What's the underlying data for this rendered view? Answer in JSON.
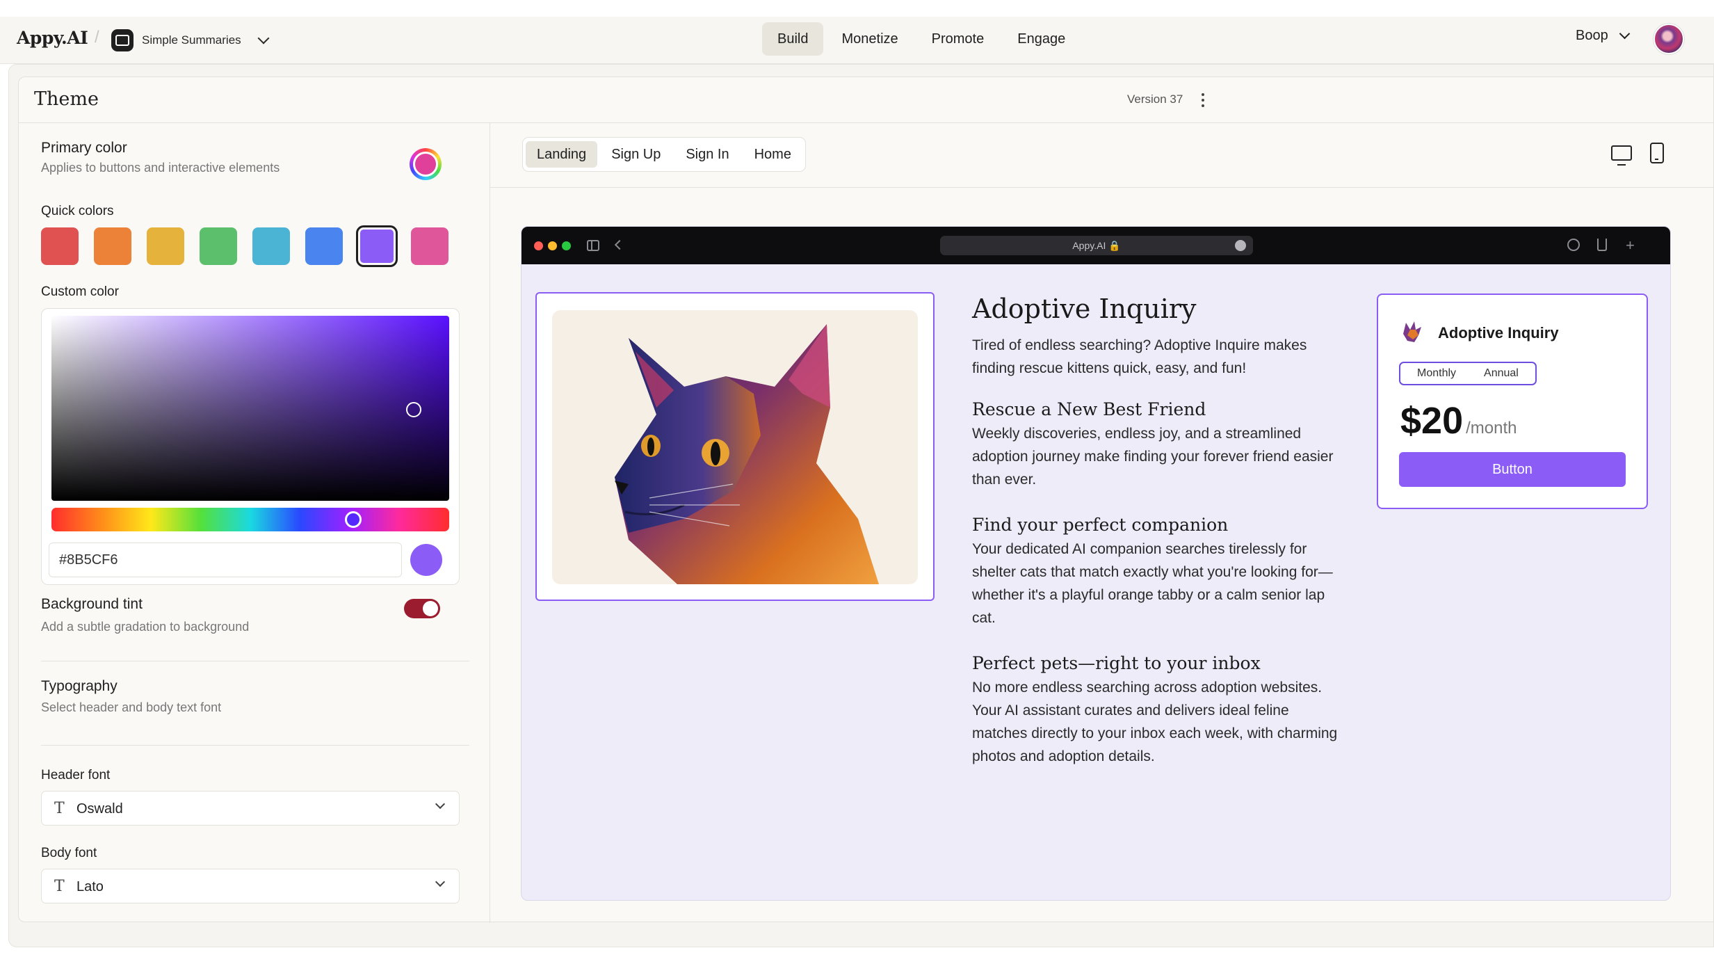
{
  "topnav": {
    "brand": "Appy.AI",
    "separator": "/",
    "app_name": "Simple Summaries",
    "tabs": [
      {
        "label": "Build",
        "active": true
      },
      {
        "label": "Monetize",
        "active": false
      },
      {
        "label": "Promote",
        "active": false
      },
      {
        "label": "Engage",
        "active": false
      }
    ],
    "user_name": "Boop"
  },
  "panel": {
    "title": "Theme",
    "version": "Version 37"
  },
  "theme": {
    "primary": {
      "label": "Primary color",
      "description": "Applies to buttons and interactive  elements"
    },
    "quick_colors": {
      "label": "Quick colors",
      "colors": [
        "#e05252",
        "#eb8238",
        "#e5b23b",
        "#5bbf6b",
        "#4bb3d4",
        "#4a84ee",
        "#8b5cf6",
        "#e0569a"
      ],
      "selected_index": 6
    },
    "custom": {
      "label": "Custom color",
      "hex": "#8B5CF6"
    },
    "background_tint": {
      "label": "Background tint",
      "description": "Add a subtle gradation to background",
      "enabled": true
    },
    "typography": {
      "label": "Typography",
      "description": "Select header and body text font"
    },
    "header_font": {
      "label": "Header font",
      "value": "Oswald"
    },
    "body_font": {
      "label": "Body font",
      "value": "Lato"
    }
  },
  "preview": {
    "page_tabs": [
      {
        "label": "Landing",
        "active": true
      },
      {
        "label": "Sign Up",
        "active": false
      },
      {
        "label": "Sign In",
        "active": false
      },
      {
        "label": "Home",
        "active": false
      }
    ],
    "browser_url": "Appy.AI 🔒",
    "headline": "Adoptive Inquiry",
    "intro": "Tired of endless searching? Adoptive Inquire makes finding rescue kittens quick, easy, and fun!",
    "sections": [
      {
        "title": "Rescue a New Best Friend",
        "body": "Weekly discoveries, endless joy, and a streamlined adoption journey make finding your forever friend easier than ever."
      },
      {
        "title": "Find your perfect companion",
        "body": "Your dedicated AI companion searches tirelessly for shelter cats that match exactly what you're looking for—whether it's a playful orange tabby or a calm senior lap cat."
      },
      {
        "title": "Perfect pets—right to your inbox",
        "body": "No more endless searching across adoption websites. Your AI assistant curates and delivers ideal feline matches directly to your inbox each week, with charming photos and adoption details."
      }
    ],
    "pricing": {
      "title": "Adoptive Inquiry",
      "options": [
        "Monthly",
        "Annual"
      ],
      "price": "$20",
      "period": "/month",
      "button": "Button"
    }
  }
}
